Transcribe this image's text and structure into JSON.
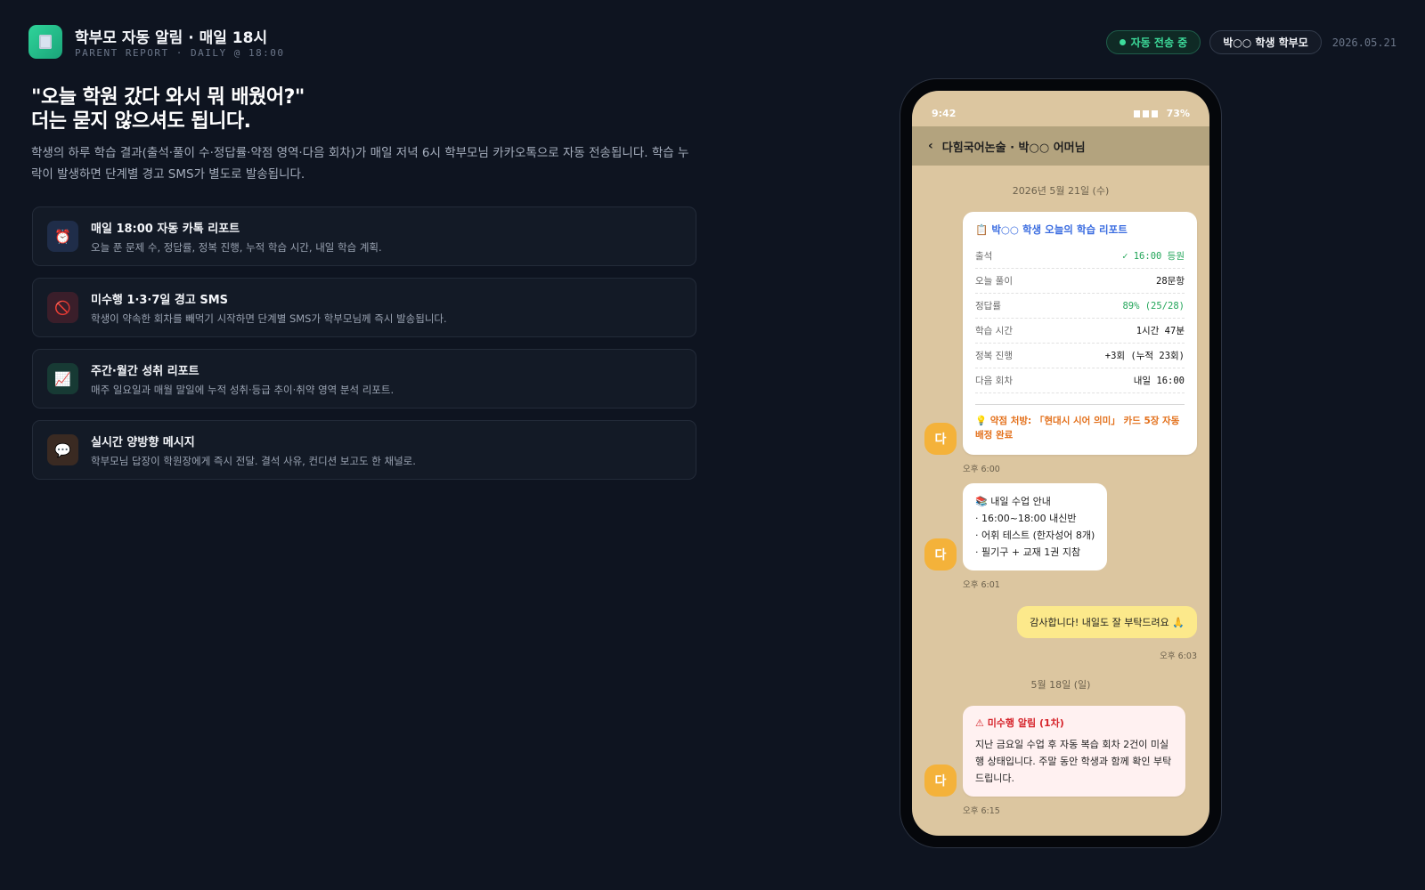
{
  "header": {
    "title": "학부모 자동 알림 · 매일 18시",
    "subtitle": "PARENT REPORT · DAILY @ 18:00",
    "status_label": "자동 전송 중",
    "user_label": "박○○ 학생 학부모",
    "date": "2026.05.21"
  },
  "hero": {
    "headline_1": "\"오늘 학원 갔다 와서 뭐 배웠어?\"",
    "headline_2": "더는 묻지 않으셔도 됩니다.",
    "description": "학생의 하루 학습 결과(출석·풀이 수·정답률·약점 영역·다음 회차)가 매일 저녁 6시 학부모님 카카오톡으로 자동 전송됩니다. 학습 누락이 발생하면 단계별 경고 SMS가 별도로 발송됩니다."
  },
  "features": [
    {
      "icon": "alarm-clock-icon",
      "glyph": "⏰",
      "color": "#1f2d49",
      "title": "매일 18:00 자동 카톡 리포트",
      "desc": "오늘 푼 문제 수, 정답률, 정복 진행, 누적 학습 시간, 내일 학습 계획."
    },
    {
      "icon": "no-entry-icon",
      "glyph": "🚫",
      "color": "#3a1e2a",
      "title": "미수행 1·3·7일 경고 SMS",
      "desc": "학생이 약속한 회차를 빼먹기 시작하면 단계별 SMS가 학부모님께 즉시 발송됩니다."
    },
    {
      "icon": "chart-up-icon",
      "glyph": "📈",
      "color": "#173a34",
      "title": "주간·월간 성취 리포트",
      "desc": "매주 일요일과 매월 말일에 누적 성취·등급 추이·취약 영역 분석 리포트."
    },
    {
      "icon": "speech-bubble-icon",
      "glyph": "💬",
      "color": "#3a2a22",
      "title": "실시간 양방향 메시지",
      "desc": "학부모님 답장이 학원장에게 즉시 전달. 결석 사유, 컨디션 보고도 한 채널로."
    }
  ],
  "phone": {
    "time": "9:42",
    "battery": "73%",
    "chat_title": "다힘국어논술 · 박○○ 어머님",
    "avatar_letter": "다",
    "day1": "2026년 5월 21일 (수)",
    "report": {
      "title": "📋 박○○ 학생 오늘의 학습 리포트",
      "rows": [
        {
          "k": "출석",
          "v": "✓ 16:00 등원",
          "tone": "green"
        },
        {
          "k": "오늘 풀이",
          "v": "28문항",
          "tone": ""
        },
        {
          "k": "정답률",
          "v": "89% (25/28)",
          "tone": "green"
        },
        {
          "k": "학습 시간",
          "v": "1시간 47분",
          "tone": ""
        },
        {
          "k": "정복 진행",
          "v": "+3회 (누적 23회)",
          "tone": ""
        },
        {
          "k": "다음 회차",
          "v": "내일 16:00",
          "tone": ""
        }
      ],
      "footer": "💡 약점 처방: 「현대시 시어 의미」 카드 5장 자동 배정 완료"
    },
    "ts1": "오후 6:00",
    "notice_lines": [
      "📚 내일 수업 안내",
      "· 16:00~18:00 내신반",
      "· 어휘 테스트 (한자성어 8개)",
      "· 필기구 + 교재 1권 지참"
    ],
    "ts2": "오후 6:01",
    "reply": "감사합니다! 내일도 잘 부탁드려요 🙏",
    "ts3": "오후 6:03",
    "day2": "5월 18일 (일)",
    "alert_title": "⚠ 미수행 알림 (1차)",
    "alert_body": "지난 금요일 수업 후 자동 복습 회차 2건이 미실행 상태입니다. 주말 동안 학생과 함께 확인 부탁드립니다.",
    "ts4": "오후 6:15"
  }
}
